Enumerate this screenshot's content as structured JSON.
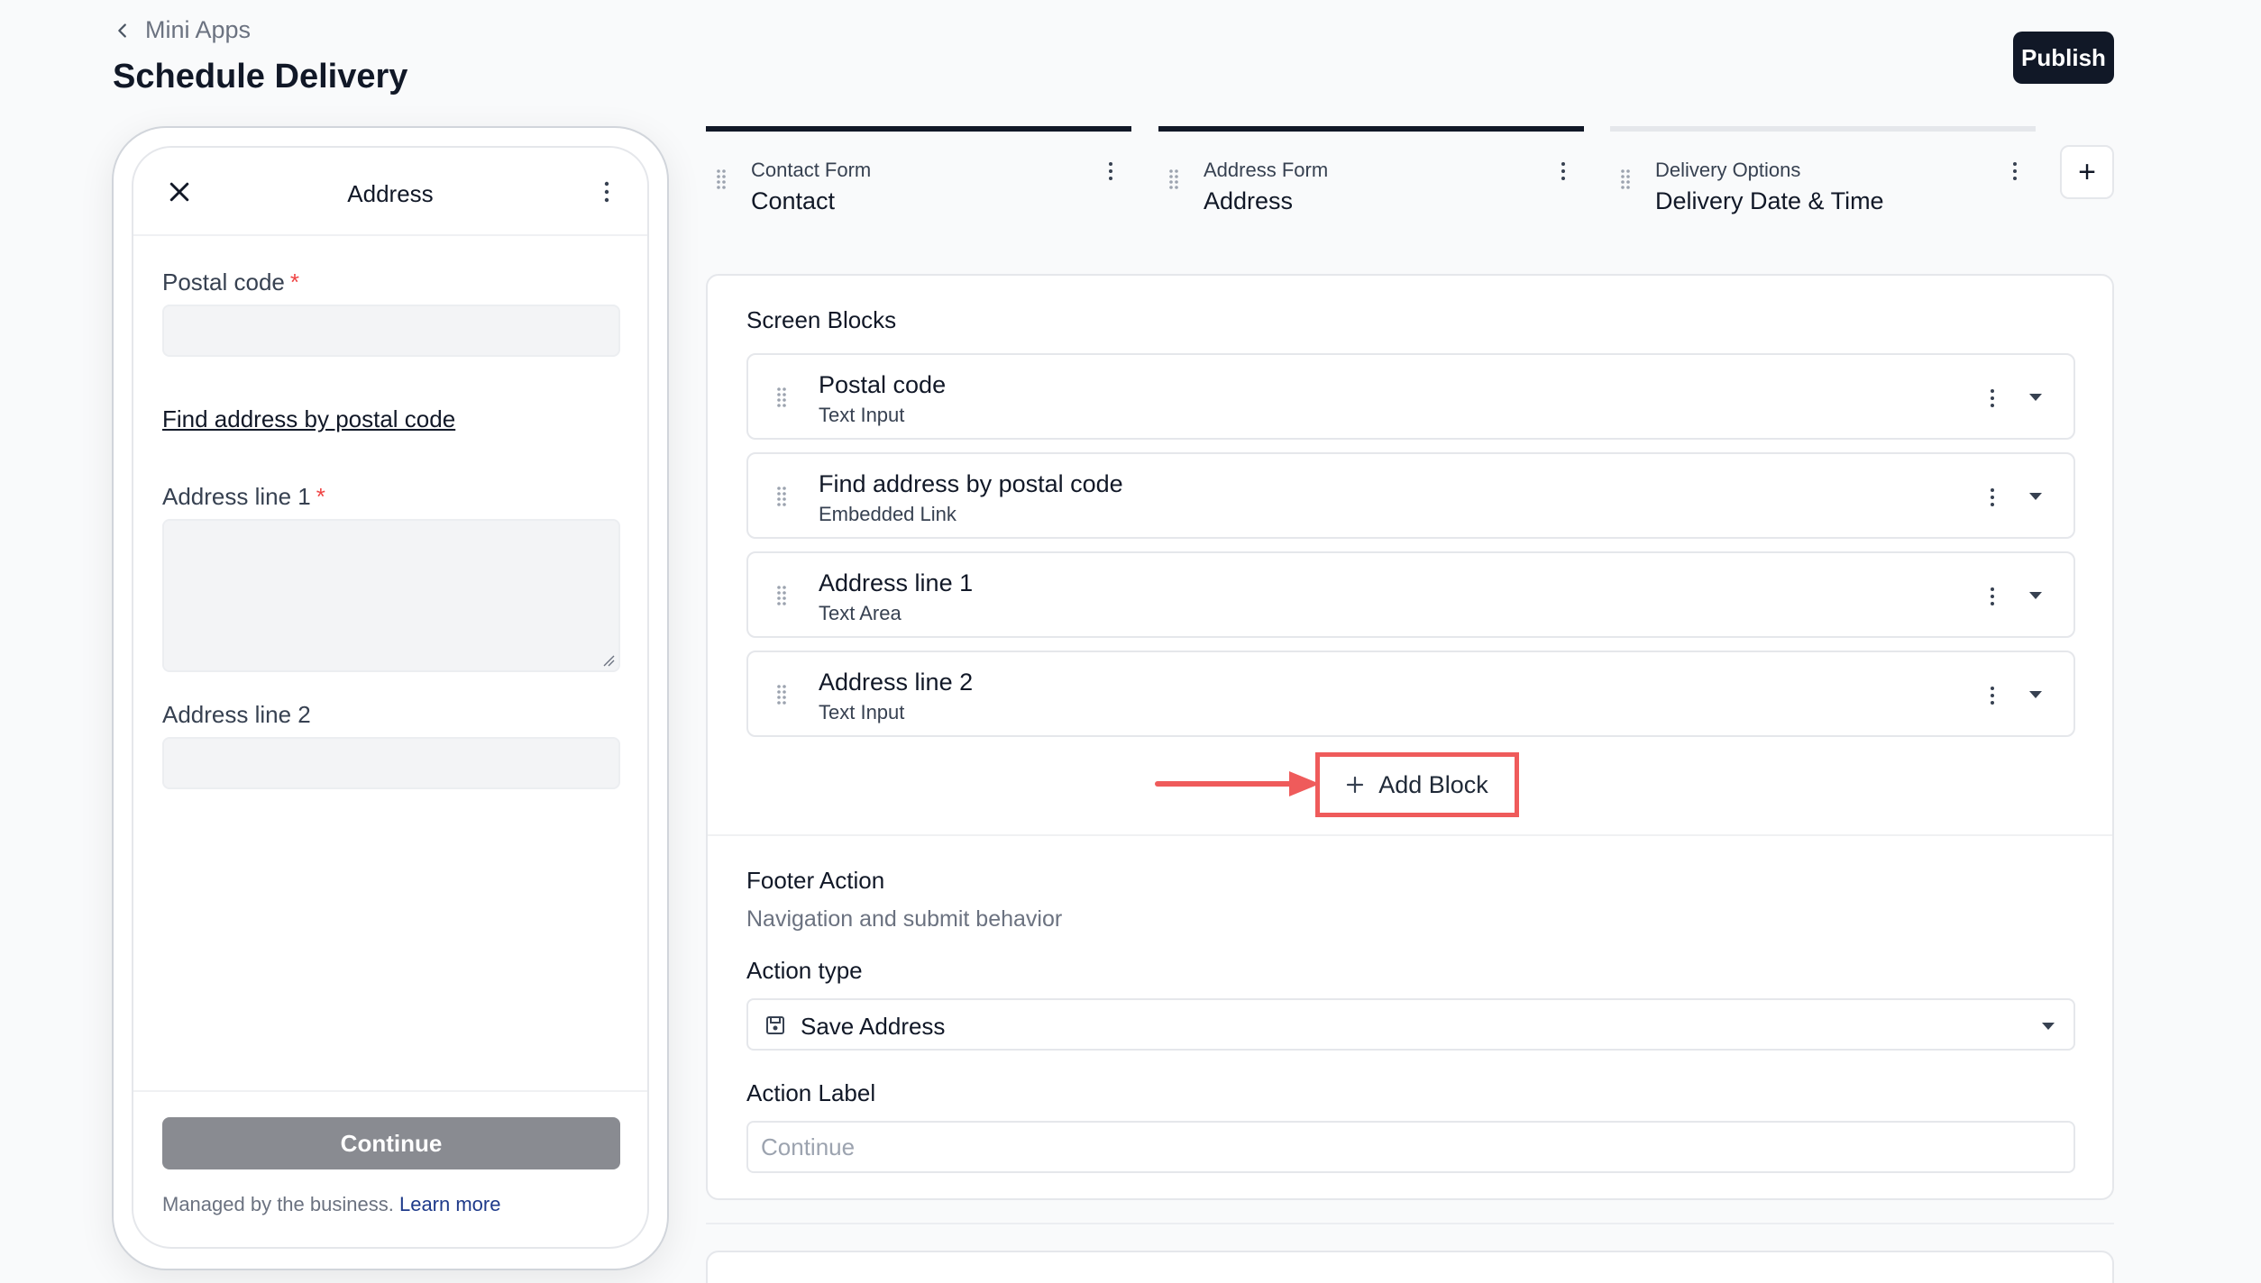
{
  "header": {
    "back_label": "Mini Apps",
    "title": "Schedule Delivery",
    "publish_label": "Publish"
  },
  "phone": {
    "screen_title": "Address",
    "fields": [
      {
        "label": "Postal code",
        "required": "*"
      },
      {
        "label": "Address line 1",
        "required": "*"
      },
      {
        "label": "Address line 2"
      }
    ],
    "link_text": "Find address by postal code",
    "continue_label": "Continue",
    "managed_text": "Managed by the business.",
    "learn_more": "Learn more"
  },
  "tabs": [
    {
      "sub": "Contact Form",
      "name": "Contact",
      "active": true
    },
    {
      "sub": "Address Form",
      "name": "Address",
      "active": true
    },
    {
      "sub": "Delivery Options",
      "name": "Delivery Date & Time",
      "active": false
    }
  ],
  "panel": {
    "blocks_heading": "Screen Blocks",
    "blocks": [
      {
        "name": "Postal code",
        "type": "Text Input"
      },
      {
        "name": "Find address by postal code",
        "type": "Embedded Link"
      },
      {
        "name": "Address line 1",
        "type": "Text Area"
      },
      {
        "name": "Address line 2",
        "type": "Text Input"
      }
    ],
    "add_block_label": "Add Block",
    "footer_heading": "Footer Action",
    "footer_sub": "Navigation and submit behavior",
    "action_type_label": "Action type",
    "action_type_value": "Save Address",
    "action_label_label": "Action Label",
    "action_label_placeholder": "Continue"
  },
  "colors": {
    "primary": "#111827",
    "required": "#ef4444",
    "highlight": "#ef5b5b",
    "disabled_button": "#898b91"
  }
}
